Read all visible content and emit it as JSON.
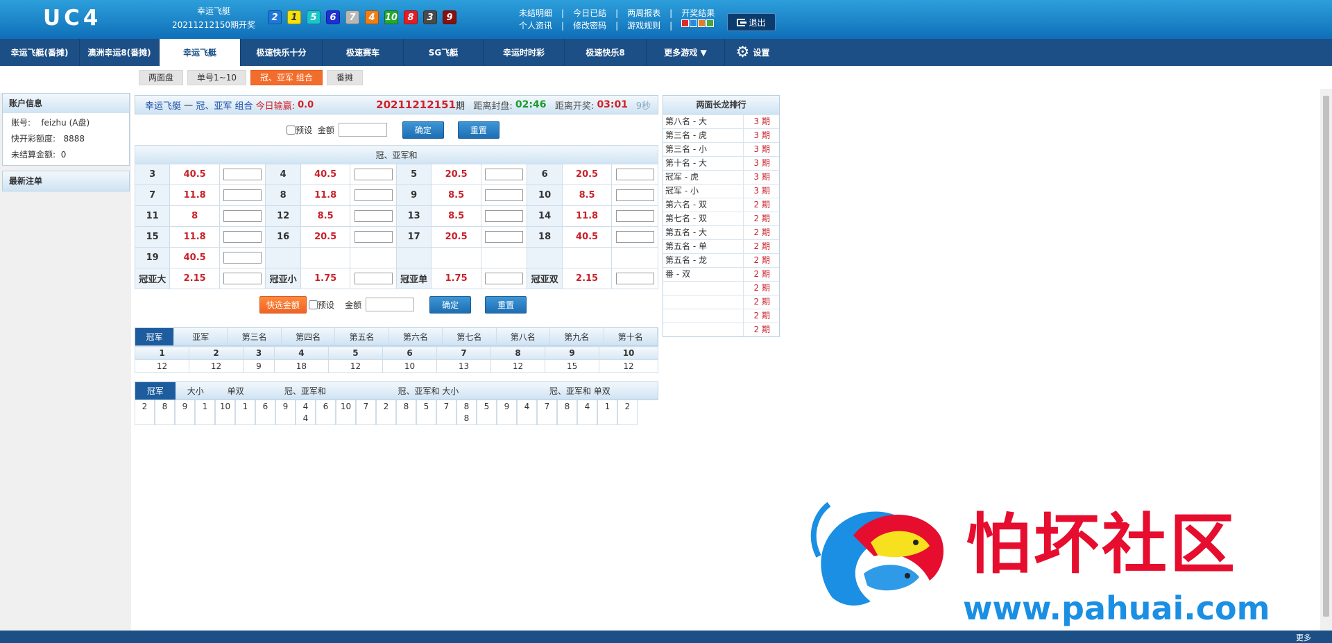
{
  "header": {
    "logo": "UC4",
    "game_name": "幸运飞艇",
    "draw_text": "20211212150期开奖",
    "balls": [
      {
        "n": "2",
        "color": "#1e78d8"
      },
      {
        "n": "1",
        "color": "#f5e10c"
      },
      {
        "n": "5",
        "color": "#19c6c9"
      },
      {
        "n": "6",
        "color": "#1f2fd6"
      },
      {
        "n": "7",
        "color": "#b8b8b8"
      },
      {
        "n": "4",
        "color": "#ee7f14"
      },
      {
        "n": "10",
        "color": "#24a830"
      },
      {
        "n": "8",
        "color": "#e41d24"
      },
      {
        "n": "3",
        "color": "#4a4a4a"
      },
      {
        "n": "9",
        "color": "#8a0f0f"
      }
    ],
    "links_row1": [
      "未结明细",
      "今日已结",
      "两周报表",
      "开奖结果"
    ],
    "links_row2": [
      "个人资讯",
      "修改密码",
      "游戏规则"
    ],
    "skins": [
      "#e02a2a",
      "#2a8ad8",
      "#e07c2a",
      "#4aa83a"
    ],
    "logout": "退出"
  },
  "nav": {
    "items": [
      "幸运飞艇(番摊)",
      "澳洲幸运8(番摊)",
      "幸运飞艇",
      "极速快乐十分",
      "极速赛车",
      "SG飞艇",
      "幸运时时彩",
      "极速快乐8",
      "更多游戏 ▼"
    ],
    "settings": "设置"
  },
  "subtabs": [
    "两面盘",
    "单号1~10",
    "冠、亚军 组合",
    "番摊"
  ],
  "account": {
    "title": "账户信息",
    "account_label": "账号:",
    "account_value": "feizhu (A盘)",
    "quota_label": "快开彩额度:",
    "quota_value": "8888",
    "unsettled_label": "未结算金额:",
    "unsettled_value": "0",
    "latest_title": "最新注单"
  },
  "panel": {
    "game": "幸运飞艇",
    "dash": "一",
    "play": "冠、亚军 组合",
    "today_label": "今日输赢:",
    "today_value": "0.0",
    "period": "20211212151",
    "period_suffix": "期",
    "close_label": "距离封盘:",
    "close_time": "02:46",
    "open_label": "距离开奖:",
    "open_time": "03:01",
    "refresh": "9秒"
  },
  "bet": {
    "preset": "预设",
    "amount": "金额",
    "confirm": "确定",
    "reset": "重置",
    "quick": "快选金额"
  },
  "odds_table": {
    "title": "冠、亚军和",
    "rows": [
      [
        [
          "3",
          "40.5"
        ],
        [
          "4",
          "40.5"
        ],
        [
          "5",
          "20.5"
        ],
        [
          "6",
          "20.5"
        ]
      ],
      [
        [
          "7",
          "11.8"
        ],
        [
          "8",
          "11.8"
        ],
        [
          "9",
          "8.5"
        ],
        [
          "10",
          "8.5"
        ]
      ],
      [
        [
          "11",
          "8"
        ],
        [
          "12",
          "8.5"
        ],
        [
          "13",
          "8.5"
        ],
        [
          "14",
          "11.8"
        ]
      ],
      [
        [
          "15",
          "11.8"
        ],
        [
          "16",
          "20.5"
        ],
        [
          "17",
          "20.5"
        ],
        [
          "18",
          "40.5"
        ]
      ],
      [
        [
          "19",
          "40.5"
        ]
      ],
      [
        [
          "冠亚大",
          "2.15"
        ],
        [
          "冠亚小",
          "1.75"
        ],
        [
          "冠亚单",
          "1.75"
        ],
        [
          "冠亚双",
          "2.15"
        ]
      ]
    ]
  },
  "stats": {
    "tabs": [
      "冠军",
      "亚军",
      "第三名",
      "第四名",
      "第五名",
      "第六名",
      "第七名",
      "第八名",
      "第九名",
      "第十名"
    ],
    "numbers": [
      "1",
      "2",
      "3",
      "4",
      "5",
      "6",
      "7",
      "8",
      "9",
      "10"
    ],
    "counts": [
      "12",
      "12",
      "9",
      "18",
      "12",
      "10",
      "13",
      "12",
      "15",
      "12"
    ]
  },
  "road": {
    "tabs": [
      "冠军",
      "大小",
      "单双",
      "冠、亚军和",
      "冠、亚军和 大小",
      "冠、亚军和 单双"
    ],
    "cells": [
      [
        "2"
      ],
      [
        "8"
      ],
      [
        "9"
      ],
      [
        "1"
      ],
      [
        "10"
      ],
      [
        "1"
      ],
      [
        "6"
      ],
      [
        "9"
      ],
      [
        "4",
        "4"
      ],
      [
        "6"
      ],
      [
        "10"
      ],
      [
        "7"
      ],
      [
        "2"
      ],
      [
        "8"
      ],
      [
        "5"
      ],
      [
        "7"
      ],
      [
        "8",
        "8"
      ],
      [
        "5"
      ],
      [
        "9"
      ],
      [
        "4"
      ],
      [
        "7"
      ],
      [
        "8"
      ],
      [
        "4"
      ],
      [
        "1"
      ],
      [
        "2"
      ]
    ]
  },
  "ranking": {
    "title": "两面长龙排行",
    "rows": [
      [
        "第八名 - 大",
        "3 期"
      ],
      [
        "第三名 - 虎",
        "3 期"
      ],
      [
        "第三名 - 小",
        "3 期"
      ],
      [
        "第十名 - 大",
        "3 期"
      ],
      [
        "冠军 - 虎",
        "3 期"
      ],
      [
        "冠军 - 小",
        "3 期"
      ],
      [
        "第六名 - 双",
        "2 期"
      ],
      [
        "第七名 - 双",
        "2 期"
      ],
      [
        "第五名 - 大",
        "2 期"
      ],
      [
        "第五名 - 单",
        "2 期"
      ],
      [
        "第五名 - 龙",
        "2 期"
      ],
      [
        "番 - 双",
        "2 期"
      ],
      [
        "",
        "2 期"
      ],
      [
        "",
        "2 期"
      ],
      [
        "",
        "2 期"
      ],
      [
        "",
        "2 期"
      ]
    ]
  },
  "footer": {
    "more": "更多"
  },
  "watermark": {
    "cn": "怕坏社区",
    "url": "www.pahuai.com"
  }
}
